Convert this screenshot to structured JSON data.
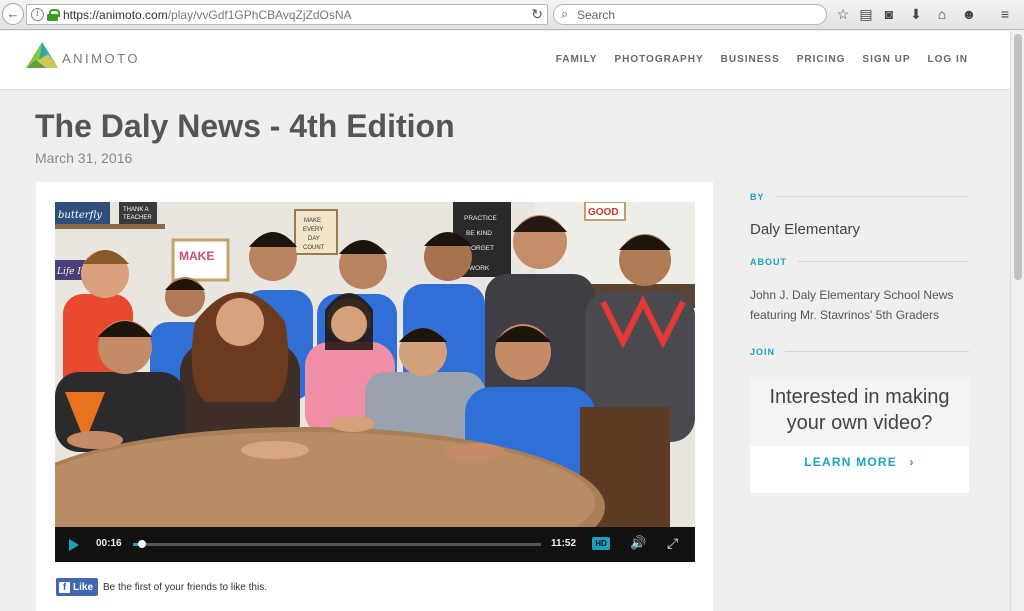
{
  "browser": {
    "url_main": "https://animoto.com",
    "url_path": "/play/vvGdf1GPhCBAvqZjZdOsNA",
    "search_placeholder": "Search"
  },
  "site": {
    "brand": "ANIMOTO",
    "nav": [
      "FAMILY",
      "PHOTOGRAPHY",
      "BUSINESS",
      "PRICING",
      "SIGN UP",
      "LOG IN"
    ]
  },
  "page": {
    "title": "The Daly News - 4th Edition",
    "date": "March 31, 2016"
  },
  "player": {
    "current_time": "00:16",
    "total_time": "11:52",
    "progress_fraction": 0.022,
    "quality": "HD"
  },
  "facebook": {
    "like_label": "Like",
    "prompt": "Be the first of your friends to like this."
  },
  "sidebar": {
    "by_label": "BY",
    "author": "Daly Elementary",
    "about_label": "ABOUT",
    "about_text": "John J. Daly Elementary School News featuring Mr. Stavrinos' 5th Graders",
    "join_label": "JOIN",
    "join_heading": "Interested in making your own video?",
    "learn_more": "LEARN MORE",
    "learn_more_arrow": "›"
  },
  "video_signs": {
    "good": "GOOD",
    "make": "MAKE",
    "make_every_day_count": [
      "MAKE",
      "EVERY",
      "DAY",
      "COUNT"
    ],
    "practice_board": [
      "PRACTICE",
      "BE KIND",
      "FORGET",
      "WORK"
    ],
    "thank_teacher": [
      "THANK A",
      "TEACHER"
    ],
    "butterfly": "butterfly",
    "life_in": "Life In"
  },
  "colors": {
    "accent": "#1aa3c1",
    "facebook": "#4267b2"
  }
}
